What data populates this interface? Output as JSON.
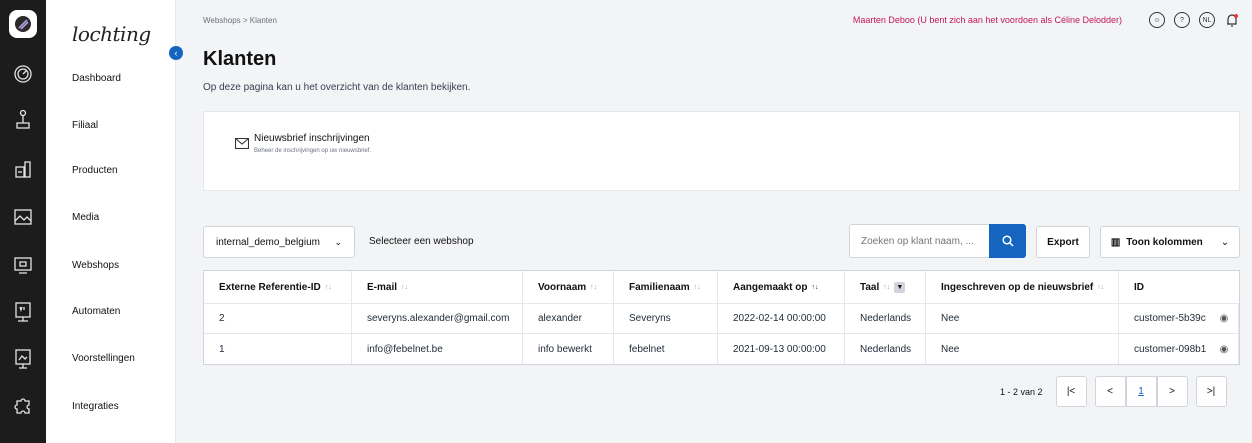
{
  "nav": {
    "brand": "lochting",
    "items": [
      {
        "label": "Dashboard",
        "icon": "gauge-icon"
      },
      {
        "label": "Filiaal",
        "icon": "store-icon"
      },
      {
        "label": "Producten",
        "icon": "products-icon"
      },
      {
        "label": "Media",
        "icon": "image-icon"
      },
      {
        "label": "Webshops",
        "icon": "cart-icon"
      },
      {
        "label": "Automaten",
        "icon": "vending-machine-icon"
      },
      {
        "label": "Voorstellingen",
        "icon": "presentation-icon"
      },
      {
        "label": "Integraties",
        "icon": "puzzle-icon"
      }
    ]
  },
  "header": {
    "breadcrumb": "Webshops > Klanten",
    "impersonation": "Maarten Deboo (U bent zich aan het voordoen als Céline Delodder)",
    "lang": "NL"
  },
  "page": {
    "title": "Klanten",
    "subtitle": "Op deze pagina kan u het overzicht van de klanten bekijken."
  },
  "newsletter_card": {
    "title": "Nieuwsbrief inschrijvingen",
    "desc": "Beheer de inschrijvingen op uw nieuwsbrief."
  },
  "toolbar": {
    "webshop_value": "internal_demo_belgium",
    "webshop_label": "Selecteer een webshop",
    "search_placeholder": "Zoeken op klant naam, ...",
    "export_label": "Export",
    "columns_label": "Toon kolommen"
  },
  "table": {
    "headers": [
      "Externe Referentie-ID",
      "E-mail",
      "Voornaam",
      "Familienaam",
      "Aangemaakt op",
      "Taal",
      "Ingeschreven op de nieuwsbrief",
      "ID"
    ],
    "rows": [
      [
        "2",
        "severyns.alexander@gmail.com",
        "alexander",
        "Severyns",
        "2022-02-14 00:00:00",
        "Nederlands",
        "Nee",
        "customer-5b39c"
      ],
      [
        "1",
        "info@febelnet.be",
        "info bewerkt",
        "febelnet",
        "2021-09-13 00:00:00",
        "Nederlands",
        "Nee",
        "customer-098b1"
      ]
    ]
  },
  "pagination": {
    "info": "1 - 2 van 2",
    "first": "|<",
    "prev": "<",
    "page": "1",
    "next": ">",
    "last": ">|"
  },
  "colors": {
    "accent": "#1565c0",
    "impersonation": "#c2185b",
    "rail": "#1c1c1c"
  }
}
